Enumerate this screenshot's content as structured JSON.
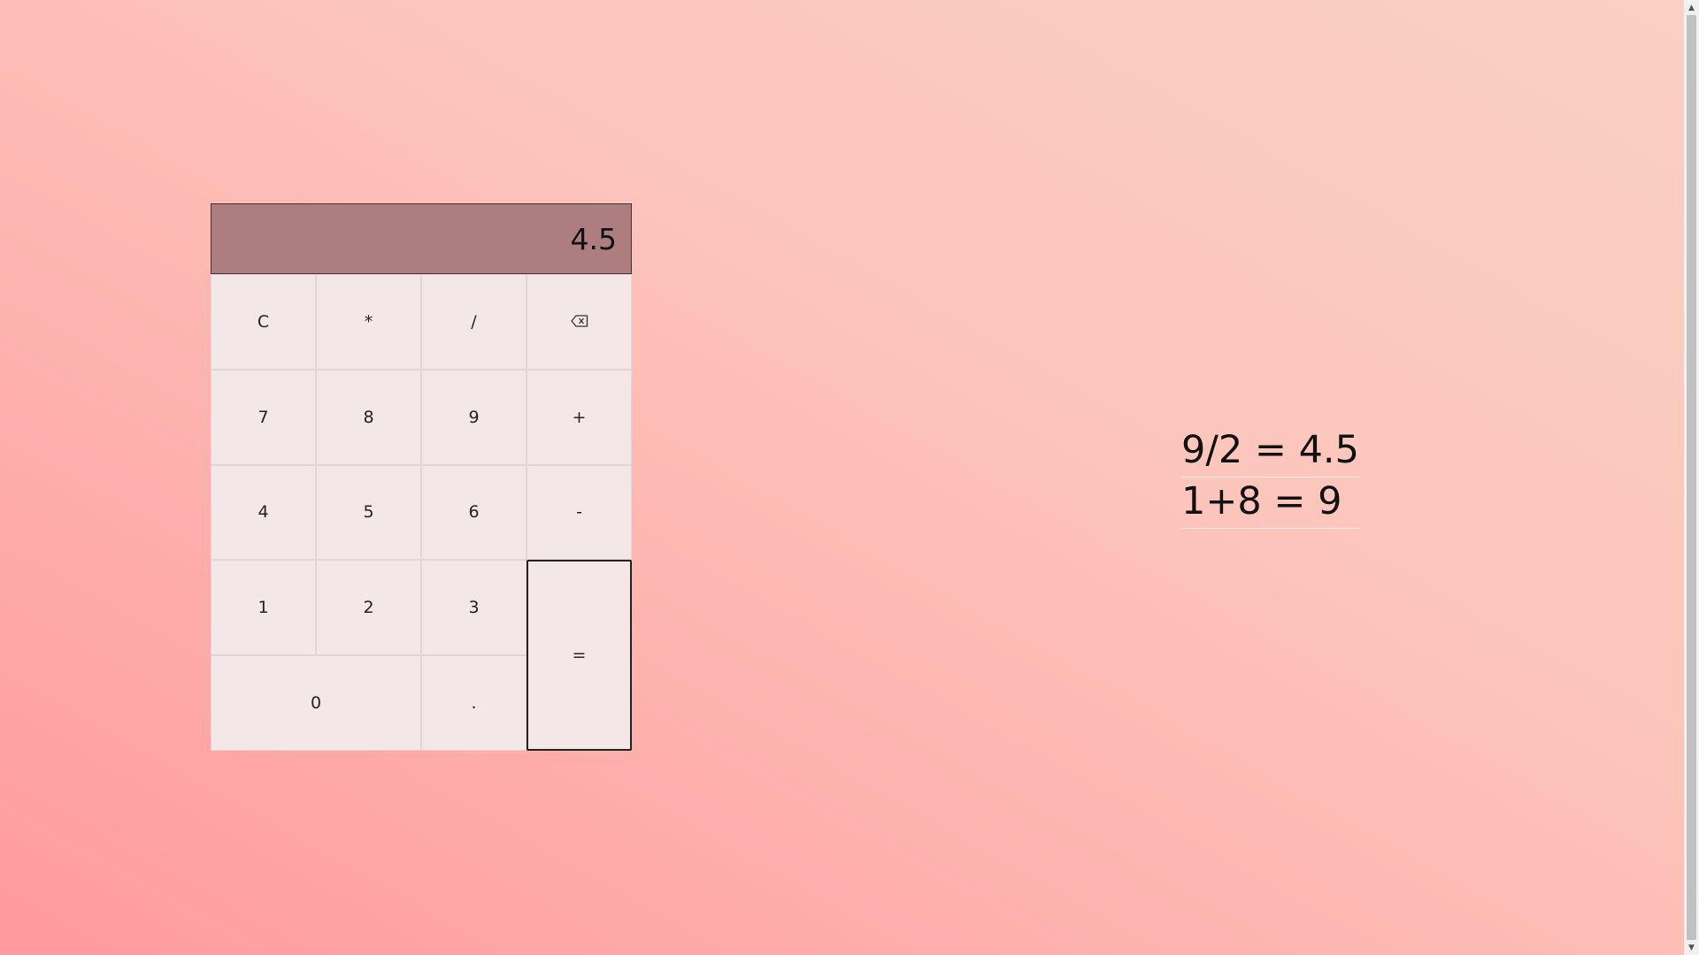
{
  "calculator": {
    "display": "4.5",
    "keys": {
      "clear": "C",
      "multiply": "*",
      "divide": "/",
      "backspace_icon": "backspace-icon",
      "seven": "7",
      "eight": "8",
      "nine": "9",
      "plus": "+",
      "four": "4",
      "five": "5",
      "six": "6",
      "minus": "-",
      "one": "1",
      "two": "2",
      "three": "3",
      "equals": "=",
      "zero": "0",
      "decimal": "."
    }
  },
  "history": [
    "9/2 = 4.5",
    "1+8 = 9"
  ],
  "colors": {
    "display_bg": "#ad7e7f",
    "key_bg": "#f3e7e7",
    "gradient_start": "#ff9a9e",
    "gradient_end": "#fad0c4"
  }
}
